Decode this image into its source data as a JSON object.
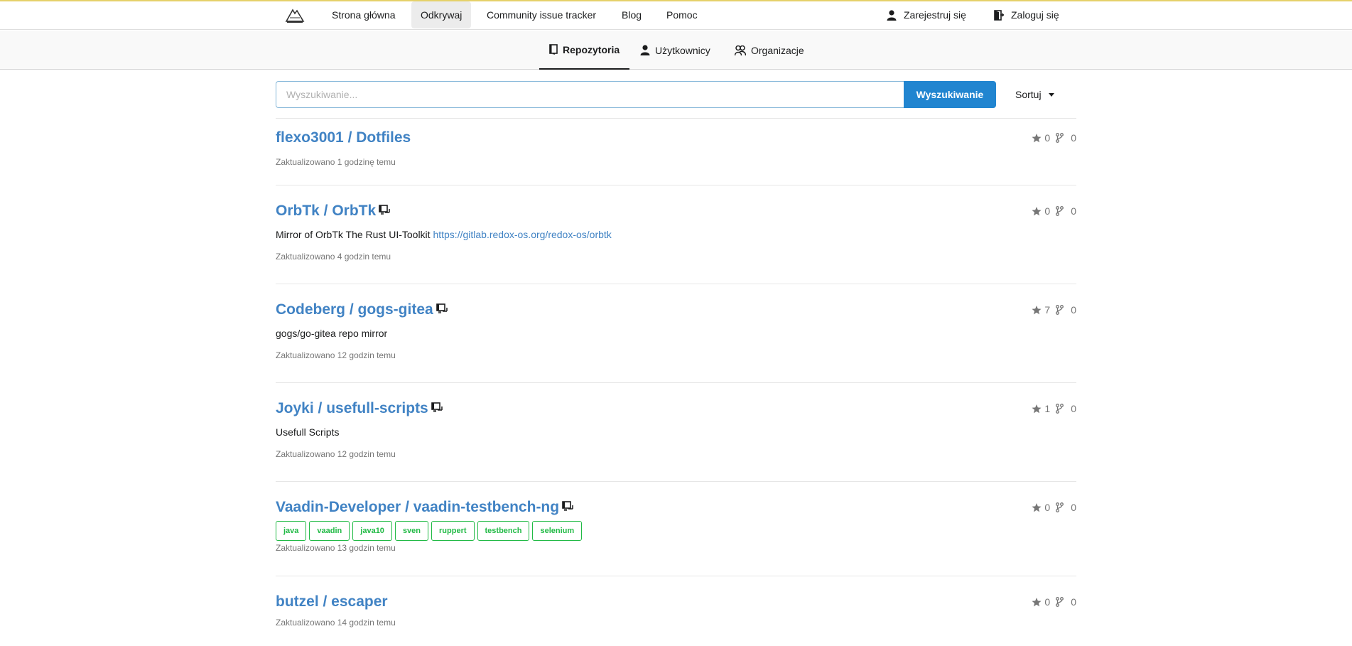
{
  "nav": {
    "items": [
      {
        "label": "Strona główna"
      },
      {
        "label": "Odkrywaj"
      },
      {
        "label": "Community issue tracker"
      },
      {
        "label": "Blog"
      },
      {
        "label": "Pomoc"
      }
    ],
    "register_label": "Zarejestruj się",
    "login_label": "Zaloguj się"
  },
  "tabs": [
    {
      "label": "Repozytoria",
      "icon": "repo-icon"
    },
    {
      "label": "Użytkownicy",
      "icon": "user-icon"
    },
    {
      "label": "Organizacje",
      "icon": "organization-icon"
    }
  ],
  "search": {
    "placeholder": "Wyszukiwanie...",
    "value": "",
    "button_label": "Wyszukiwanie",
    "sort_label": "Sortuj"
  },
  "repos": [
    {
      "title": "flexo3001 / Dotfiles",
      "mirror": false,
      "stars": "0",
      "forks": "0",
      "description": "",
      "link": "",
      "topics": [],
      "updated": "Zaktualizowano 1 godzinę temu"
    },
    {
      "title": "OrbTk / OrbTk",
      "mirror": true,
      "stars": "0",
      "forks": "0",
      "description": "Mirror of OrbTk The Rust UI-Toolkit",
      "link": "https://gitlab.redox-os.org/redox-os/orbtk",
      "topics": [],
      "updated": "Zaktualizowano 4 godzin temu"
    },
    {
      "title": "Codeberg / gogs-gitea",
      "mirror": true,
      "stars": "7",
      "forks": "0",
      "description": "gogs/go-gitea repo mirror",
      "link": "",
      "topics": [],
      "updated": "Zaktualizowano 12 godzin temu"
    },
    {
      "title": "Joyki / usefull-scripts",
      "mirror": true,
      "stars": "1",
      "forks": "0",
      "description": "Usefull Scripts",
      "link": "",
      "topics": [],
      "updated": "Zaktualizowano 12 godzin temu"
    },
    {
      "title": "Vaadin-Developer / vaadin-testbench-ng",
      "mirror": true,
      "stars": "0",
      "forks": "0",
      "description": "",
      "link": "",
      "topics": [
        "java",
        "vaadin",
        "java10",
        "sven",
        "ruppert",
        "testbench",
        "selenium"
      ],
      "updated": "Zaktualizowano 13 godzin temu"
    },
    {
      "title": "butzel / escaper",
      "mirror": false,
      "stars": "0",
      "forks": "0",
      "description": "",
      "link": "",
      "topics": [],
      "updated": "Zaktualizowano 14 godzin temu"
    }
  ]
}
